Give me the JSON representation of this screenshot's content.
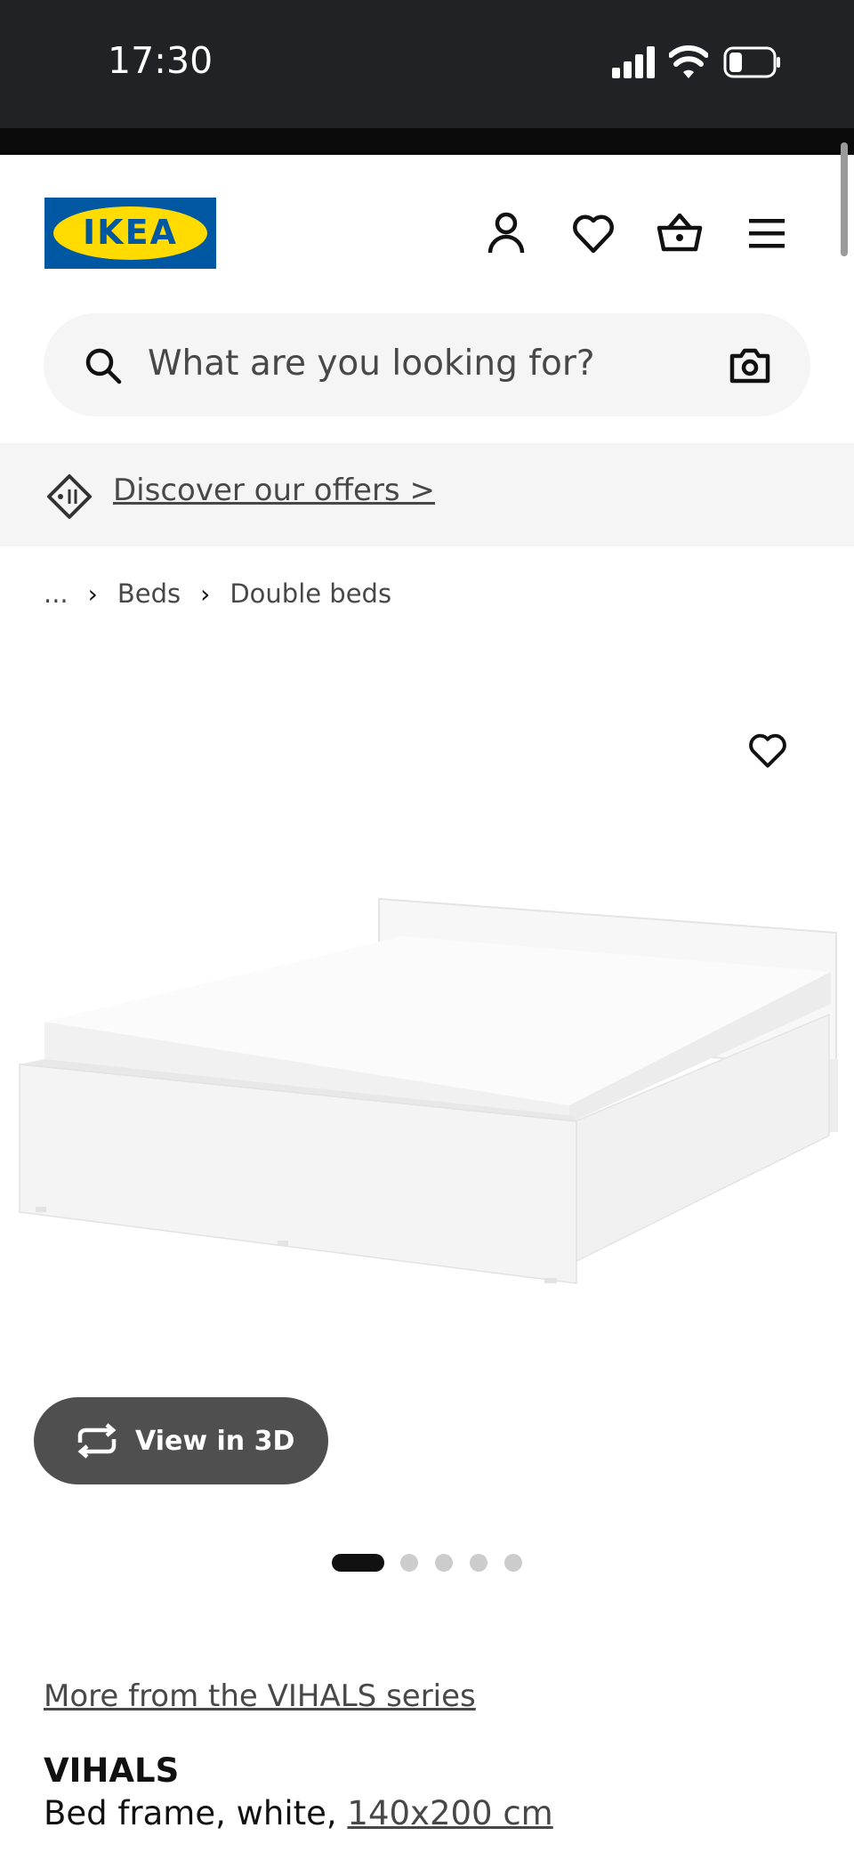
{
  "status_bar": {
    "time": "17:30",
    "icons": [
      "cellular-signal-icon",
      "wifi-icon",
      "battery-icon"
    ]
  },
  "header": {
    "logo_text": "IKEA",
    "icons": [
      "profile-icon",
      "heart-icon",
      "basket-icon",
      "menu-icon"
    ]
  },
  "search": {
    "placeholder": "What are you looking for?",
    "icons": [
      "search-icon",
      "camera-icon"
    ]
  },
  "offers": {
    "label": "Discover our offers >",
    "icon": "tag-icon"
  },
  "breadcrumb": {
    "items": [
      "...",
      "Beds",
      "Double beds"
    ]
  },
  "product_image": {
    "favourite_icon": "heart-icon",
    "view_3d_label": "View in 3D",
    "view_3d_icon": "rotate-3d-icon",
    "carousel_total": 5,
    "carousel_active": 1
  },
  "product": {
    "series_link": "More from the VIHALS series",
    "name": "VIHALS",
    "description_prefix": "Bed frame, white, ",
    "size": "140x200 cm"
  },
  "colors": {
    "ikea_blue": "#0058a3",
    "ikea_yellow": "#ffdb00",
    "status_bar_bg": "#202226",
    "band_bg": "#f5f5f5"
  }
}
